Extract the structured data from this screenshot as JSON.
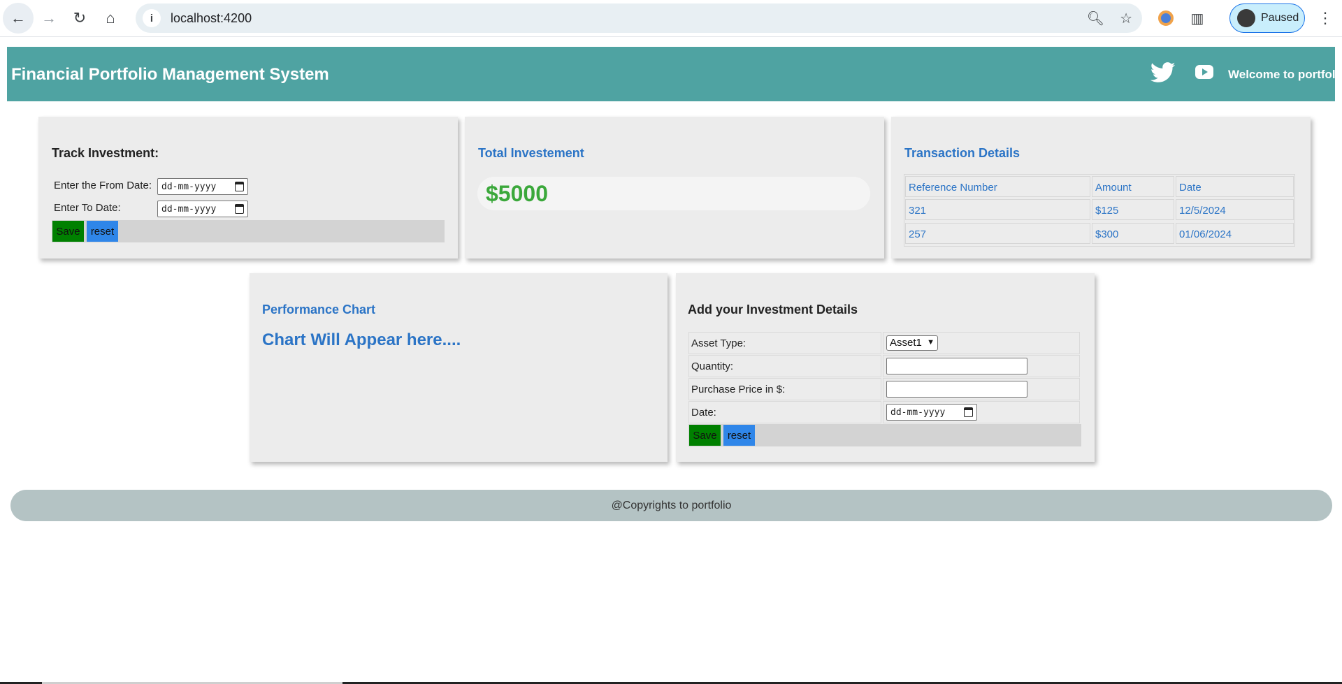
{
  "browser": {
    "url": "localhost:4200",
    "profile_status": "Paused",
    "icons": [
      "back-icon",
      "forward-icon",
      "reload-icon",
      "home-icon",
      "info-icon",
      "zoom-icon",
      "star-icon",
      "extension-icon",
      "puzzle-icon",
      "kebab-icon"
    ]
  },
  "header": {
    "title": "Financial Portfolio Management System",
    "welcome": "Welcome to portfolio",
    "bg_color": "#4fa3a2"
  },
  "track": {
    "title": "Track Investment:",
    "from_label": "Enter the From Date:",
    "to_label": "Enter To Date:",
    "date_placeholder": "dd-mm-yyyy",
    "save_label": "Save",
    "reset_label": "reset"
  },
  "total": {
    "title": "Total Investement",
    "value": "$5000"
  },
  "transactions": {
    "title": "Transaction Details",
    "headers": [
      "Reference Number",
      "Amount",
      "Date"
    ],
    "rows": [
      [
        "321",
        "$125",
        "12/5/2024"
      ],
      [
        "257",
        "$300",
        "01/06/2024"
      ]
    ]
  },
  "performance": {
    "title": "Performance Chart",
    "message": "Chart Will Appear here...."
  },
  "add_investment": {
    "title": "Add your Investment Details",
    "asset_label": "Asset Type:",
    "asset_value": "Asset1",
    "quantity_label": "Quantity:",
    "price_label": "Purchase Price in $:",
    "date_label": "Date:",
    "date_placeholder": "dd-mm-yyyy",
    "save_label": "Save",
    "reset_label": "reset"
  },
  "footer": {
    "text": "@Copyrights to portfolio"
  }
}
